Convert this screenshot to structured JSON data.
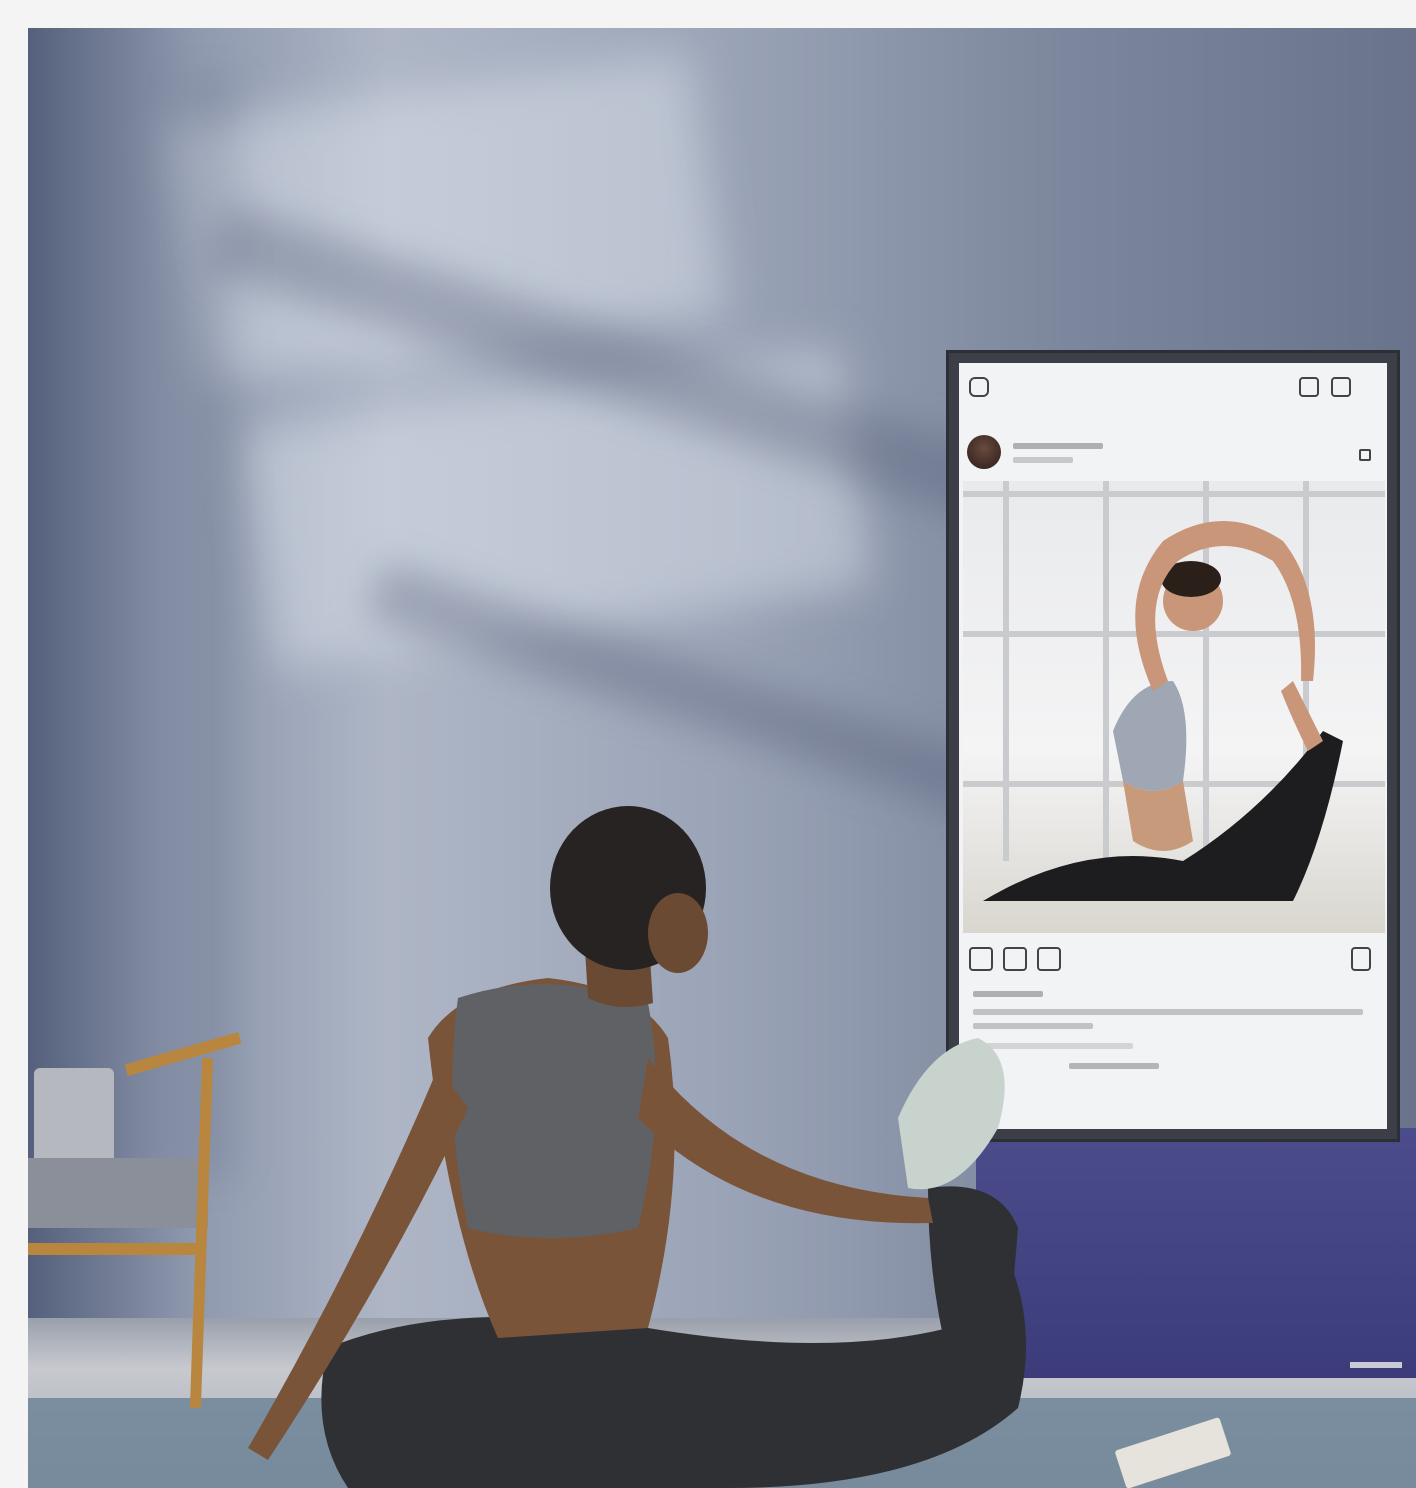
{
  "scene": {
    "description_colors": {
      "wall": "#9ba4b7",
      "tv_stand": "#3b3c79",
      "chair_wood": "#b8863f",
      "outfit": "#5f6165",
      "skin": "#7a5439"
    }
  },
  "tv_post": {
    "username": "",
    "location": "",
    "likes": "",
    "caption": "",
    "comments_link": ""
  },
  "icons": [
    "camera-icon",
    "igtv-icon",
    "direct-message-icon",
    "like-icon",
    "comment-icon",
    "share-icon",
    "save-icon",
    "more-options-icon"
  ]
}
